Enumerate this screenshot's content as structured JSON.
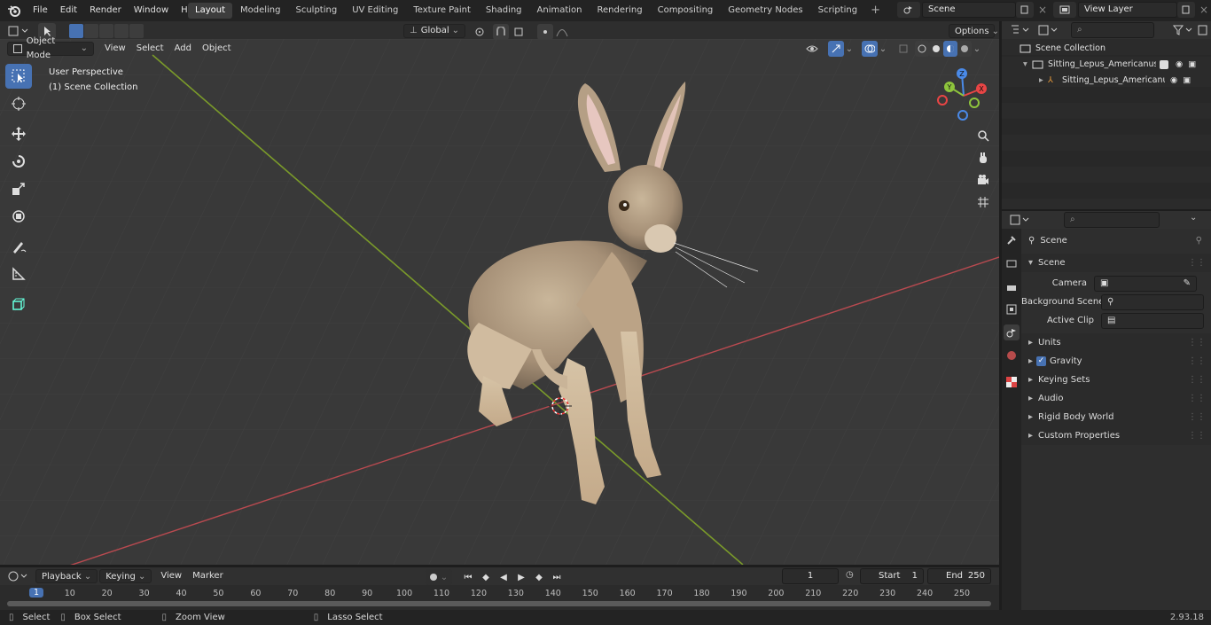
{
  "topbar": {
    "menus": [
      "File",
      "Edit",
      "Render",
      "Window",
      "Help"
    ],
    "workspaces": [
      "Layout",
      "Modeling",
      "Sculpting",
      "UV Editing",
      "Texture Paint",
      "Shading",
      "Animation",
      "Rendering",
      "Compositing",
      "Geometry Nodes",
      "Scripting"
    ],
    "active_workspace": "Layout",
    "scene": "Scene",
    "view_layer": "View Layer"
  },
  "tool_header": {
    "transform_orientation": "Global",
    "options": "Options"
  },
  "viewport_header": {
    "mode": "Object Mode",
    "menus": [
      "View",
      "Select",
      "Add",
      "Object"
    ]
  },
  "viewport": {
    "perspective": "User Perspective",
    "collection": "(1) Scene Collection",
    "gizmo_labels": {
      "z": "Z",
      "y": "Y",
      "x": "X"
    }
  },
  "outliner": {
    "root": "Scene Collection",
    "items": [
      "Sitting_Lepus_Americanus",
      "Sitting_Lepus_Americanu"
    ]
  },
  "properties": {
    "context": "Scene",
    "panel": "Scene",
    "fields": [
      "Camera",
      "Background Scene",
      "Active Clip"
    ],
    "subpanels": [
      "Units",
      "Gravity",
      "Keying Sets",
      "Audio",
      "Rigid Body World",
      "Custom Properties"
    ]
  },
  "timeline": {
    "menus": [
      "Playback",
      "Keying",
      "View",
      "Marker"
    ],
    "current_frame": "1",
    "start_label": "Start",
    "start": "1",
    "end_label": "End",
    "end": "250",
    "ticks": [
      "1",
      "10",
      "20",
      "30",
      "40",
      "50",
      "60",
      "70",
      "80",
      "90",
      "100",
      "110",
      "120",
      "130",
      "140",
      "150",
      "160",
      "170",
      "180",
      "190",
      "200",
      "210",
      "220",
      "230",
      "240",
      "250"
    ]
  },
  "statusbar": {
    "items": [
      "Select",
      "Box Select",
      "Zoom View",
      "Lasso Select"
    ],
    "version": "2.93.18"
  },
  "colors": {
    "accent": "#4772b3",
    "x_axis": "#e84545",
    "y_axis": "#8ec43c",
    "z_axis": "#4a8ae8"
  }
}
